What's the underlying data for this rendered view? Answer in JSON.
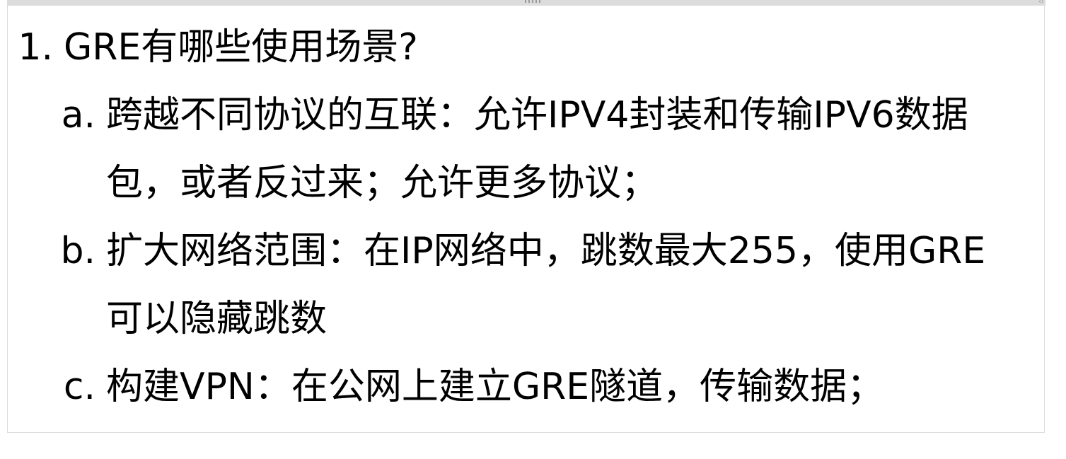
{
  "outline": {
    "item1": {
      "marker": "1.",
      "text": "GRE有哪些使用场景?"
    },
    "subitems": [
      {
        "marker": "a.",
        "line1": "跨越不同协议的互联：允许IPV4封装和传输IPV6数据",
        "line2": "包，或者反过来；允许更多协议；"
      },
      {
        "marker": "b.",
        "line1": "扩大网络范围：在IP网络中，跳数最大255，使用GRE",
        "line2": "可以隐藏跳数"
      },
      {
        "marker": "c.",
        "line1": "构建VPN：在公网上建立GRE隧道，传输数据；"
      }
    ]
  }
}
